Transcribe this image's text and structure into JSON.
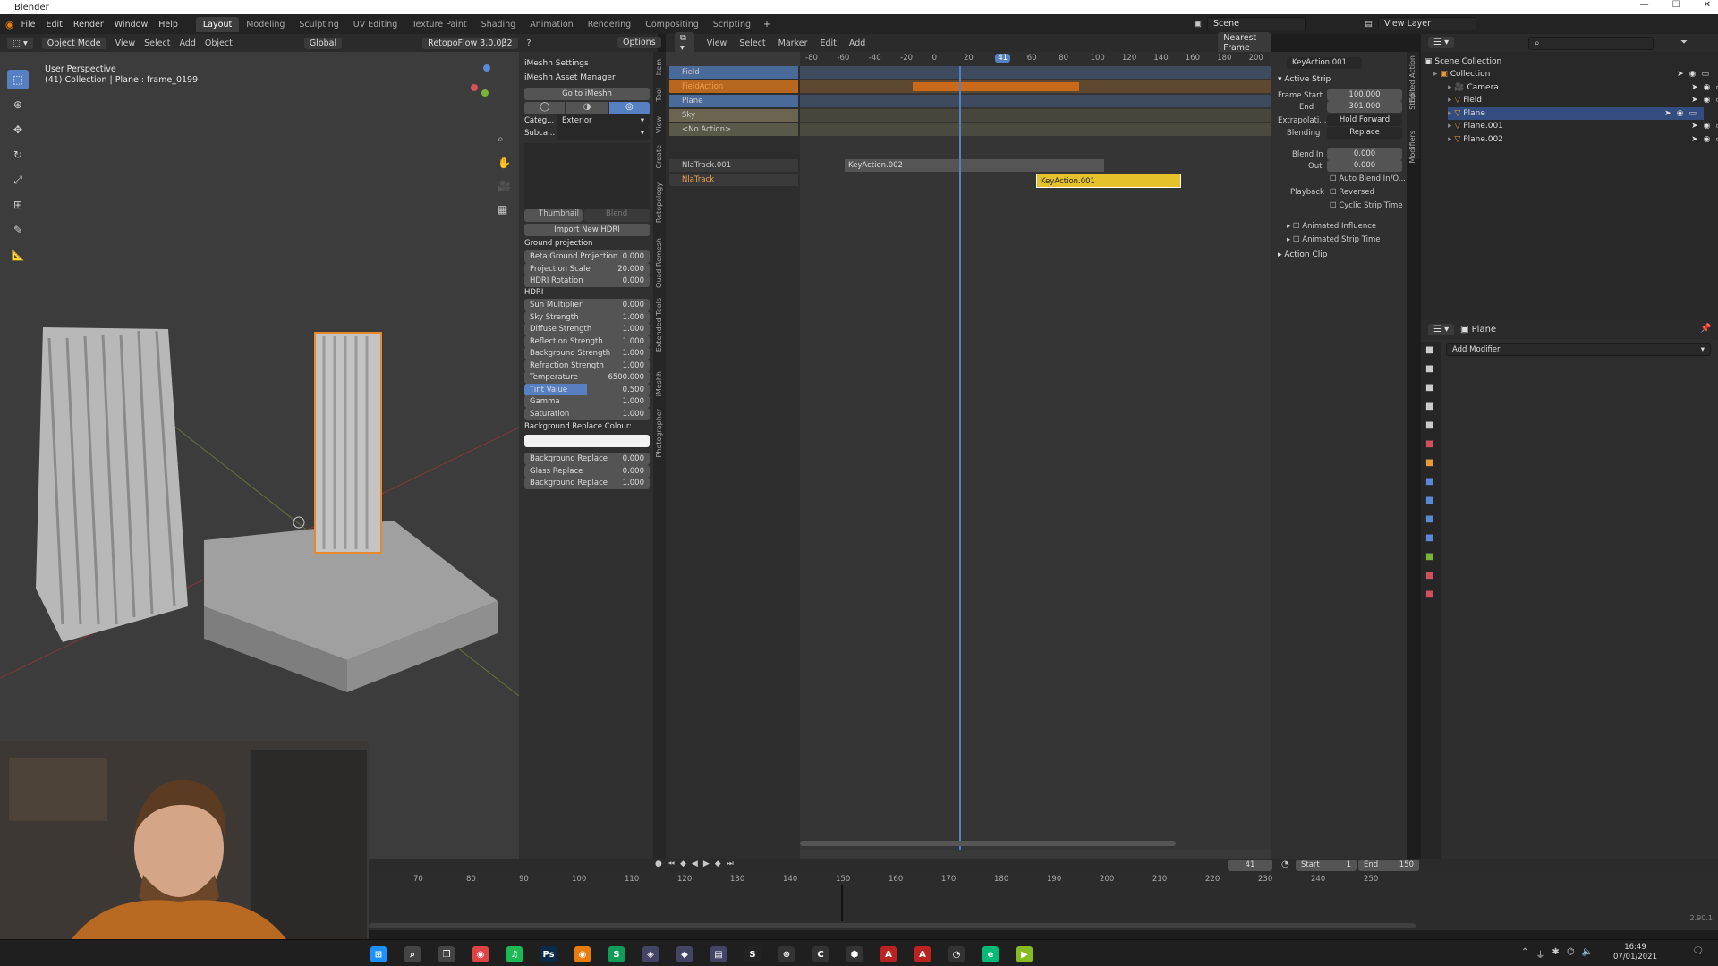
{
  "window": {
    "title": "Blender"
  },
  "menu": [
    "File",
    "Edit",
    "Render",
    "Window",
    "Help"
  ],
  "workspaces": [
    "Layout",
    "Modeling",
    "Sculpting",
    "UV Editing",
    "Texture Paint",
    "Shading",
    "Animation",
    "Rendering",
    "Compositing",
    "Scripting"
  ],
  "active_workspace": "Layout",
  "scene": {
    "scene_label": "Scene",
    "view_layer": "View Layer"
  },
  "viewport": {
    "mode": "Object Mode",
    "menus": [
      "View",
      "Select",
      "Add",
      "Object"
    ],
    "transform": "Global",
    "addon": "RetopoFlow 3.0.0β2",
    "options": "Options",
    "perspective": "User Perspective",
    "collection_line": "(41) Collection | Plane : frame_0199"
  },
  "npanel": {
    "settings": "iMeshh Settings",
    "asset_manager": "iMeshh Asset Manager",
    "goto": "Go to iMeshh",
    "category_label": "Categ...",
    "category_value": "Exterior",
    "subcat_label": "Subca...",
    "subcat_value": "",
    "thumbnail": "Thumbnail",
    "blend": "Blend",
    "import_hdri": "Import New HDRI",
    "ground_projection": "Ground projection",
    "ground_rows": [
      {
        "label": "Beta Ground Projection",
        "value": "0.000"
      },
      {
        "label": "Projection Scale",
        "value": "20.000"
      },
      {
        "label": "HDRI Rotation",
        "value": "0.000"
      }
    ],
    "hdri": "HDRI",
    "hdri_rows": [
      {
        "label": "Sun Multiplier",
        "value": "0.000"
      },
      {
        "label": "Sky Strength",
        "value": "1.000"
      },
      {
        "label": "Diffuse Strength",
        "value": "1.000"
      },
      {
        "label": "Reflection Strength",
        "value": "1.000"
      },
      {
        "label": "Background Strength",
        "value": "1.000"
      },
      {
        "label": "Refraction Strength",
        "value": "1.000"
      },
      {
        "label": "Temperature",
        "value": "6500.000"
      },
      {
        "label": "Tint Value",
        "value": "0.500"
      },
      {
        "label": "Gamma",
        "value": "1.000"
      },
      {
        "label": "Saturation",
        "value": "1.000"
      }
    ],
    "bg_replace_colour": "Background Replace Colour:",
    "bottom_rows": [
      {
        "label": "Background Replace",
        "value": "0.000"
      },
      {
        "label": "Glass Replace",
        "value": "0.000"
      },
      {
        "label": "Background Replace",
        "value": "1.000"
      }
    ],
    "tabs": [
      "Item",
      "Tool",
      "View",
      "Create",
      "Retopology",
      "Quad Remesh",
      "Extended Tools",
      "iMeshh",
      "Photographer"
    ]
  },
  "nla": {
    "menus": [
      "View",
      "Select",
      "Marker",
      "Edit",
      "Add"
    ],
    "snap": "Nearest Frame",
    "ruler": [
      "-80",
      "-60",
      "-40",
      "-20",
      "0",
      "20",
      "41",
      "60",
      "80",
      "100",
      "120",
      "140",
      "160",
      "180",
      "200"
    ],
    "tracks": [
      "Field",
      "FieldAction",
      "Plane",
      "Sky",
      "<No Action>",
      "NlaTrack.001",
      "NlaTrack"
    ],
    "strip_a": "KeyAction.002",
    "strip_b": "KeyAction.001"
  },
  "sidebar": {
    "action_name": "KeyAction.001",
    "active_strip": "Active Strip",
    "frame_start_label": "Frame Start",
    "frame_start": "100.000",
    "end_label": "End",
    "end": "301.000",
    "extrapolation_label": "Extrapolati...",
    "extrapolation": "Hold Forward",
    "blending_label": "Blending",
    "blending": "Replace",
    "blend_in_label": "Blend In",
    "blend_in": "0.000",
    "out_label": "Out",
    "out": "0.000",
    "auto_blend": "Auto Blend In/O...",
    "playback_label": "Playback",
    "reversed": "Reversed",
    "cyclic": "Cyclic Strip Time",
    "animated_influence": "Animated Influence",
    "animated_strip_time": "Animated Strip Time",
    "action_clip": "Action Clip",
    "tabs": [
      "Edited Action",
      "Strip",
      "Modifiers"
    ]
  },
  "outliner": {
    "root": "Scene Collection",
    "items": [
      "Collection",
      "Camera",
      "Field",
      "Plane",
      "Plane.001",
      "Plane.002"
    ],
    "selected": "Plane"
  },
  "properties": {
    "object": "Plane",
    "add_modifier": "Add Modifier"
  },
  "timeline": {
    "current_frame": "41",
    "start_label": "Start",
    "start": "1",
    "end_label": "End",
    "end": "150",
    "ticks": [
      "70",
      "80",
      "90",
      "100",
      "110",
      "120",
      "130",
      "140",
      "150",
      "160",
      "170",
      "180",
      "190",
      "200",
      "210",
      "220",
      "230",
      "240",
      "250"
    ],
    "version": "2.90.1"
  },
  "taskbar": {
    "time": "16:49",
    "date": "07/01/2021"
  },
  "colors": {
    "accent": "#5680c2",
    "strip_orange": "#c86a1a",
    "strip_yellow": "#e5c22c",
    "selection": "#334d80"
  }
}
